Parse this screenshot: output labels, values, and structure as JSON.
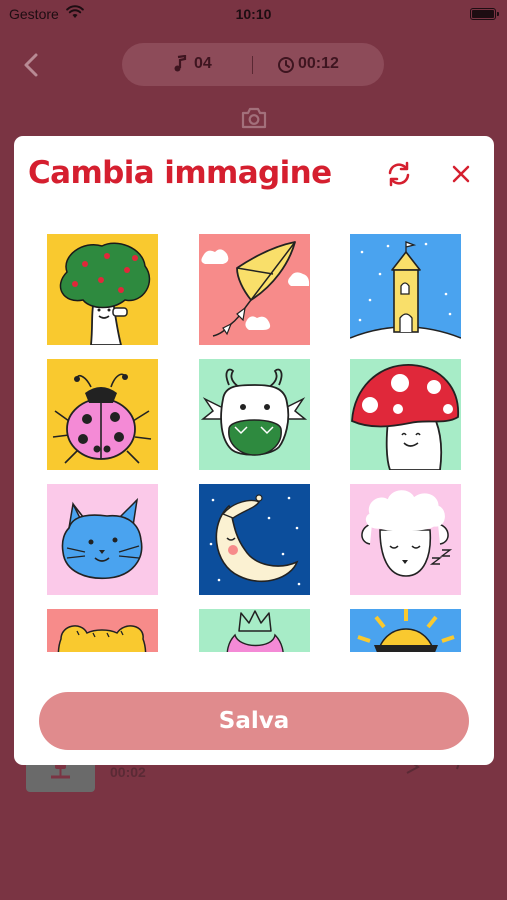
{
  "status_bar": {
    "carrier": "Gestore",
    "time": "10:10"
  },
  "header": {
    "track_count": "04",
    "duration": "00:12"
  },
  "background_row": {
    "time": "00:02"
  },
  "modal": {
    "title": "Cambia immagine",
    "save_label": "Salva",
    "images": [
      {
        "name": "tree",
        "bg": "#f9c92f"
      },
      {
        "name": "kite",
        "bg": "#f78b8a"
      },
      {
        "name": "castle",
        "bg": "#4aa3ef"
      },
      {
        "name": "ladybug",
        "bg": "#f9c92f"
      },
      {
        "name": "dragon",
        "bg": "#a7ecc7"
      },
      {
        "name": "mushroom",
        "bg": "#a7ecc7"
      },
      {
        "name": "cat",
        "bg": "#fbc9e9"
      },
      {
        "name": "moon",
        "bg": "#0c4e9c"
      },
      {
        "name": "sheep",
        "bg": "#fbc9e9"
      },
      {
        "name": "bear",
        "bg": "#f78b8a"
      },
      {
        "name": "princess",
        "bg": "#a7ecc7"
      },
      {
        "name": "sun",
        "bg": "#4aa3ef"
      }
    ]
  }
}
